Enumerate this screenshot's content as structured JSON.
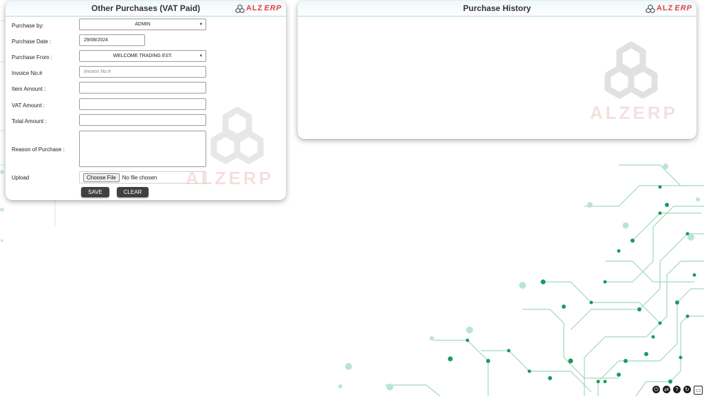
{
  "form": {
    "title": "Other Purchases (VAT Paid)",
    "logo_alz": "ALZ",
    "logo_erp": "ERP",
    "labels": {
      "purchase_by": "Purchase by:",
      "purchase_date": "Purchase Date :",
      "purchase_from": "Purchase From :",
      "invoice_no": "Invoice No.#",
      "item_amount": "Item Amount :",
      "vat_amount": "VAT Amount :",
      "total_amount": "Total Amount :",
      "reason": "Reason of Purchase :",
      "upload": "Upload"
    },
    "values": {
      "purchase_by": "ADMIN",
      "purchase_date": "29/08/2024",
      "purchase_from": "WELCOME TRADING EST.",
      "invoice_placeholder": "Invoice No.#",
      "upload_button": "Choose File",
      "upload_status": "No file chosen"
    },
    "buttons": {
      "save": "SAVE",
      "clear": "CLEAR"
    },
    "watermark": "ALZERP"
  },
  "history": {
    "title": "Purchase History",
    "logo_alz": "ALZ",
    "logo_erp": "ERP",
    "watermark": "ALZERP"
  },
  "colors": {
    "header_border": "#a9d2ea",
    "button": "#404040",
    "logo": "#e0403a",
    "circuit": "#1a9a5a"
  },
  "tray_icons": [
    "power-icon",
    "sync-icon",
    "help-icon",
    "refresh-icon",
    "window-icon"
  ]
}
